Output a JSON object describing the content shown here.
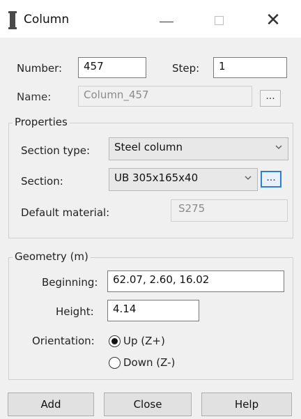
{
  "window": {
    "title": "Column",
    "minimize_glyph": "—",
    "close_glyph": "✕",
    "icon": "column-icon"
  },
  "general": {
    "number_label": "Number:",
    "number_value": "457",
    "step_label": "Step:",
    "step_value": "1",
    "name_label": "Name:",
    "name_value": "Column_457",
    "name_browse_label": "..."
  },
  "properties": {
    "group_title": "Properties",
    "section_type_label": "Section type:",
    "section_type_value": "Steel column",
    "section_label": "Section:",
    "section_value": "UB 305x165x40",
    "section_browse_label": "...",
    "material_label": "Default material:",
    "material_value": "S275"
  },
  "geometry": {
    "group_title": "Geometry (m)",
    "beginning_label": "Beginning:",
    "beginning_value": "62.07, 2.60, 16.02",
    "height_label": "Height:",
    "height_value": "4.14",
    "orientation_label": "Orientation:",
    "options": [
      {
        "label": "Up (Z+)",
        "selected": true
      },
      {
        "label": "Down (Z-)",
        "selected": false
      }
    ]
  },
  "buttons": {
    "add": "Add",
    "close": "Close",
    "help": "Help"
  },
  "colors": {
    "focus_border": "#2a7fd4",
    "window_bg": "#f0f0f0"
  }
}
